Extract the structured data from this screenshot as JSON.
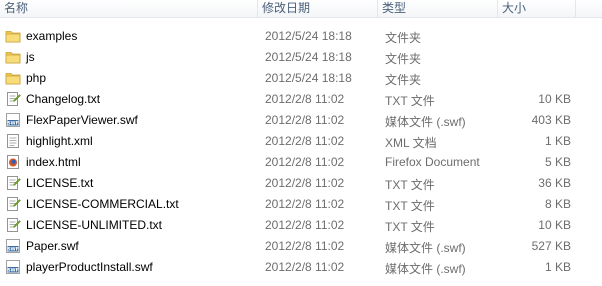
{
  "columns": {
    "name": "名称",
    "date": "修改日期",
    "type": "类型",
    "size": "大小"
  },
  "files": [
    {
      "name": "examples",
      "date": "2012/5/24 18:18",
      "type": "文件夹",
      "size": "",
      "icon": "folder-icon"
    },
    {
      "name": "js",
      "date": "2012/5/24 18:18",
      "type": "文件夹",
      "size": "",
      "icon": "folder-icon"
    },
    {
      "name": "php",
      "date": "2012/5/24 18:18",
      "type": "文件夹",
      "size": "",
      "icon": "folder-icon"
    },
    {
      "name": "Changelog.txt",
      "date": "2012/2/8 11:02",
      "type": "TXT 文件",
      "size": "10 KB",
      "icon": "text-file-icon"
    },
    {
      "name": "FlexPaperViewer.swf",
      "date": "2012/2/8 11:02",
      "type": "媒体文件 (.swf)",
      "size": "403 KB",
      "icon": "swf-file-icon"
    },
    {
      "name": "highlight.xml",
      "date": "2012/2/8 11:02",
      "type": "XML 文档",
      "size": "1 KB",
      "icon": "xml-file-icon"
    },
    {
      "name": "index.html",
      "date": "2012/2/8 11:02",
      "type": "Firefox Document",
      "size": "5 KB",
      "icon": "html-file-icon"
    },
    {
      "name": "LICENSE.txt",
      "date": "2012/2/8 11:02",
      "type": "TXT 文件",
      "size": "36 KB",
      "icon": "text-file-icon"
    },
    {
      "name": "LICENSE-COMMERCIAL.txt",
      "date": "2012/2/8 11:02",
      "type": "TXT 文件",
      "size": "8 KB",
      "icon": "text-file-icon"
    },
    {
      "name": "LICENSE-UNLIMITED.txt",
      "date": "2012/2/8 11:02",
      "type": "TXT 文件",
      "size": "10 KB",
      "icon": "text-file-icon"
    },
    {
      "name": "Paper.swf",
      "date": "2012/2/8 11:02",
      "type": "媒体文件 (.swf)",
      "size": "527 KB",
      "icon": "swf-file-icon"
    },
    {
      "name": "playerProductInstall.swf",
      "date": "2012/2/8 11:02",
      "type": "媒体文件 (.swf)",
      "size": "1 KB",
      "icon": "swf-file-icon"
    }
  ],
  "colors": {
    "folder": "#f0c84a",
    "text_file_green": "#6ea824",
    "swf_blue": "#3a6ea5",
    "firefox_orange": "#d2552a"
  }
}
